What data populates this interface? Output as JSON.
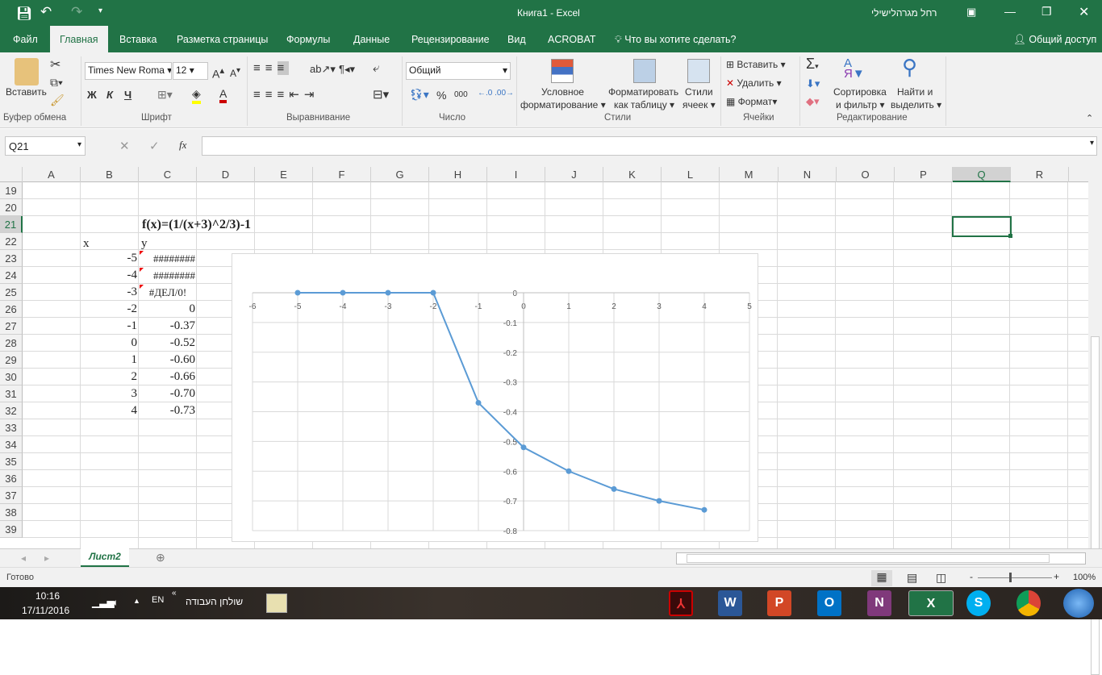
{
  "title": {
    "doc": "Книга1  -  Excel",
    "user": "רחל מגרהלישילי"
  },
  "tabs": [
    "Файл",
    "Главная",
    "Вставка",
    "Разметка страницы",
    "Формулы",
    "Данные",
    "Рецензирование",
    "Вид",
    "ACROBAT"
  ],
  "tell_me": "Что вы хотите сделать?",
  "share": "Общий доступ",
  "ribbon": {
    "paste": "Вставить",
    "font_name": "Times New Roma",
    "font_size": "12",
    "bold": "Ж",
    "italic": "К",
    "underline": "Ч",
    "number_format": "Общий",
    "cond_format_1": "Условное",
    "cond_format_2": "форматирование",
    "fmt_table_1": "Форматировать",
    "fmt_table_2": "как таблицу",
    "cell_styles_1": "Стили",
    "cell_styles_2": "ячеек",
    "insert": "Вставить",
    "delete": "Удалить",
    "format": "Формат",
    "sort_1": "Сортировка",
    "sort_2": "и фильтр",
    "find_1": "Найти и",
    "find_2": "выделить",
    "groups": [
      "Буфер обмена",
      "Шрифт",
      "Выравнивание",
      "Число",
      "Стили",
      "Ячейки",
      "Редактирование"
    ]
  },
  "formula_bar": {
    "name_box": "Q21",
    "fx": "fx",
    "value": ""
  },
  "columns": [
    "A",
    "B",
    "C",
    "D",
    "E",
    "F",
    "G",
    "H",
    "I",
    "J",
    "K",
    "L",
    "M",
    "N",
    "O",
    "P",
    "Q",
    "R"
  ],
  "rows": [
    19,
    20,
    21,
    22,
    23,
    24,
    25,
    26,
    27,
    28,
    29,
    30,
    31,
    32,
    33,
    34,
    35,
    36,
    37,
    38,
    39
  ],
  "sheet": {
    "formula_label": "f(x)=(1/(x+3)^2/3)-1",
    "x_header": "x",
    "y_header": "y",
    "data": [
      [
        "-5",
        "########"
      ],
      [
        "-4",
        "########"
      ],
      [
        "-3",
        "#ДЕЛ/0!"
      ],
      [
        "-2",
        "0"
      ],
      [
        "-1",
        "-0.37"
      ],
      [
        "0",
        "-0.52"
      ],
      [
        "1",
        "-0.60"
      ],
      [
        "2",
        "-0.66"
      ],
      [
        "3",
        "-0.70"
      ],
      [
        "4",
        "-0.73"
      ]
    ]
  },
  "chart_data": {
    "type": "scatter",
    "line": true,
    "color": "#5b9bd5",
    "x": [
      -5,
      -4,
      -3,
      -2,
      -1,
      0,
      1,
      2,
      3,
      4
    ],
    "y": [
      0,
      0,
      0,
      0,
      -0.37,
      -0.52,
      -0.6,
      -0.66,
      -0.7,
      -0.73
    ],
    "xlim": [
      -6,
      5
    ],
    "ylim": [
      -0.8,
      0
    ],
    "xticks": [
      "-6",
      "-5",
      "-4",
      "-3",
      "-2",
      "-1",
      "0",
      "1",
      "2",
      "3",
      "4",
      "5"
    ],
    "yticks": [
      "0",
      "-0.1",
      "-0.2",
      "-0.3",
      "-0.4",
      "-0.5",
      "-0.6",
      "-0.7",
      "-0.8"
    ],
    "grid": true,
    "title": "",
    "xlabel": "",
    "ylabel": ""
  },
  "sheet_tab": "Лист2",
  "status": {
    "ready": "Готово",
    "zoom": "100%"
  },
  "taskbar": {
    "time": "10:16",
    "date": "17/11/2016",
    "lang": "EN",
    "desktop": "שולחן העבודה",
    "apps": [
      "Acrobat",
      "W",
      "P",
      "O",
      "N",
      "X",
      "S",
      "Chrome"
    ]
  }
}
